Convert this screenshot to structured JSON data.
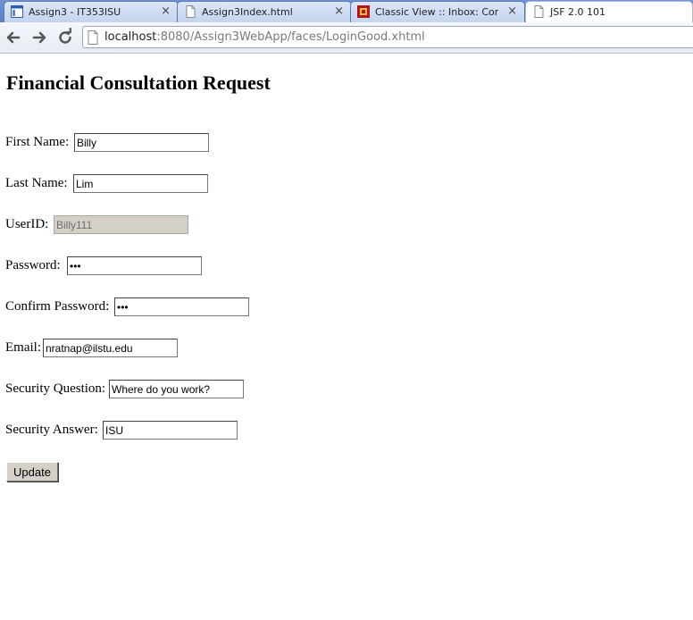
{
  "browser": {
    "tabs": [
      {
        "title": "Assign3 - IT353ISU",
        "icon": "window-icon",
        "active": false
      },
      {
        "title": "Assign3Index.html",
        "icon": "page-icon",
        "active": false
      },
      {
        "title": "Classic View :: Inbox: Congra",
        "icon": "mail-logo-icon",
        "active": false
      },
      {
        "title": "JSF 2.0 101",
        "icon": "page-icon",
        "active": true
      }
    ],
    "close_glyph": "×",
    "url_host": "localhost",
    "url_rest": ":8080/Assign3WebApp/faces/LoginGood.xhtml"
  },
  "form": {
    "heading": "Financial Consultation Request",
    "fields": [
      {
        "label": "First Name:",
        "value": "Billy"
      },
      {
        "label": "Last Name:",
        "value": "Lim"
      },
      {
        "label": "UserID:",
        "value": "Billy111",
        "readonly": true
      },
      {
        "label": "Password:",
        "value": "•••"
      },
      {
        "label": "Confirm Password:",
        "value": "•••"
      },
      {
        "label": "Email:",
        "value": "nratnap@ilstu.edu"
      },
      {
        "label": "Security Question:",
        "value": "Where do you work?"
      },
      {
        "label": "Security Answer:",
        "value": "ISU"
      }
    ],
    "submit_label": "Update"
  }
}
